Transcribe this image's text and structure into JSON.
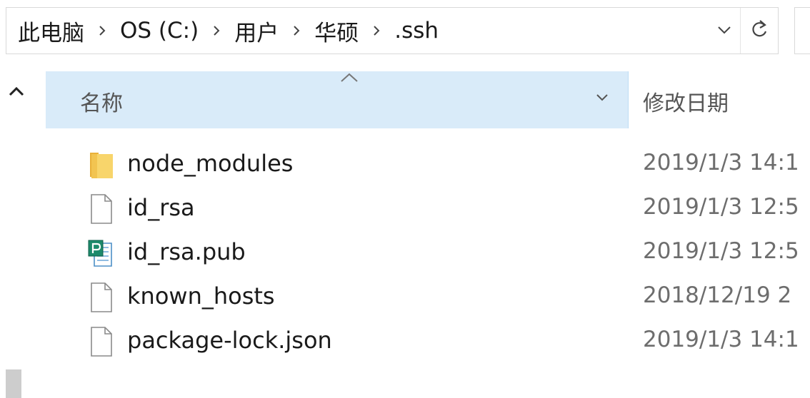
{
  "address_bar": {
    "breadcrumb": [
      "此电脑",
      "OS (C:)",
      "用户",
      "华硕",
      ".ssh"
    ],
    "icons": {
      "separator": "chevron-right-icon",
      "dropdown": "chevron-down-icon",
      "refresh": "refresh-icon"
    }
  },
  "columns": {
    "name": "名称",
    "date_modified": "修改日期",
    "sort": "ascending"
  },
  "files": [
    {
      "name": "node_modules",
      "date": "2019/1/3 14:1",
      "icon": "folder-icon"
    },
    {
      "name": "id_rsa",
      "date": "2019/1/3 12:5",
      "icon": "file-icon"
    },
    {
      "name": "id_rsa.pub",
      "date": "2019/1/3 12:5",
      "icon": "publisher-file-icon"
    },
    {
      "name": "known_hosts",
      "date": "2018/12/19 2",
      "icon": "file-icon"
    },
    {
      "name": "package-lock.json",
      "date": "2019/1/3 14:1",
      "icon": "file-icon"
    }
  ],
  "colors": {
    "header_bg": "#d9ebf9",
    "folder": "#f8d56b",
    "text": "#1a1a1a",
    "muted_text": "#6d6d6d"
  }
}
